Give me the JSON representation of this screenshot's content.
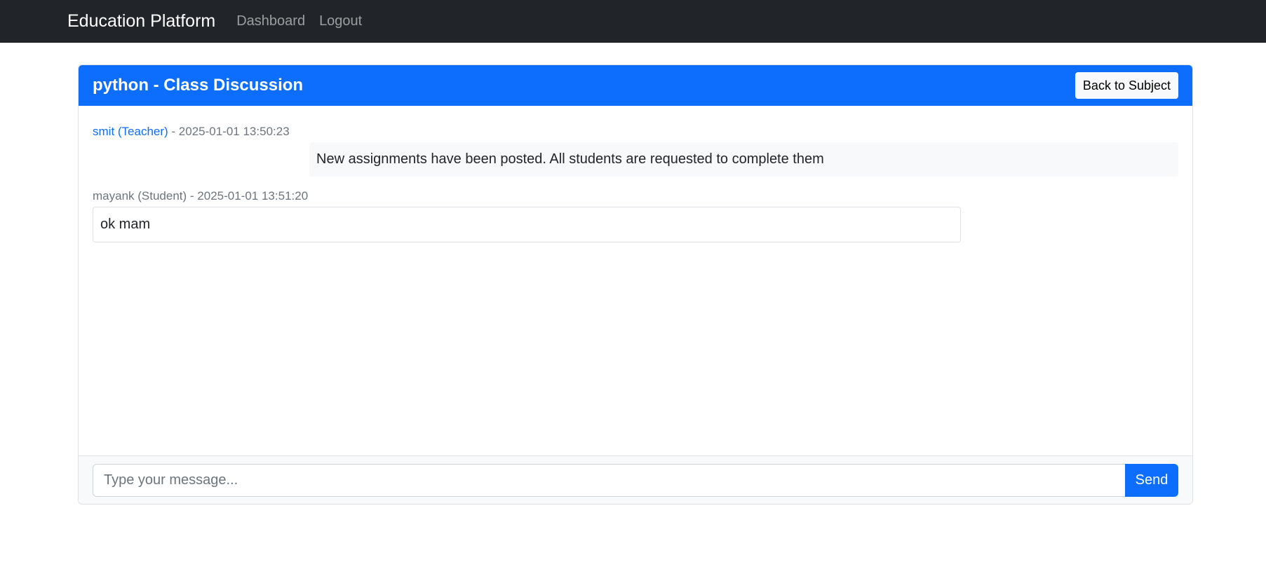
{
  "navbar": {
    "brand": "Education Platform",
    "links": [
      "Dashboard",
      "Logout"
    ]
  },
  "discussion": {
    "title": "python - Class Discussion",
    "back_label": "Back to Subject",
    "messages": [
      {
        "author": "smit (Teacher)",
        "separator": " - ",
        "timestamp": "2025-01-01 13:50:23",
        "text": "New assignments have been posted. All students are requested to complete them"
      },
      {
        "author": "mayank (Student)",
        "separator": " - ",
        "timestamp": "2025-01-01 13:51:20",
        "text": "ok mam"
      }
    ]
  },
  "composer": {
    "placeholder": "Type your message...",
    "send_label": "Send"
  },
  "colors": {
    "navbar": "#212529",
    "primary": "#0d6efd",
    "light": "#f8f9fa"
  }
}
